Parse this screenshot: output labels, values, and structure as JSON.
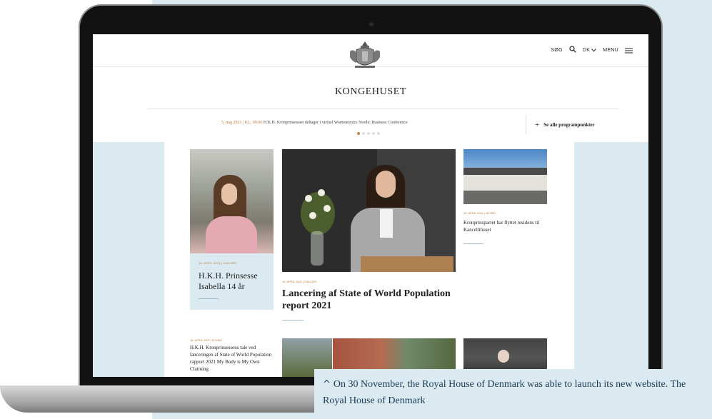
{
  "site": {
    "search_label": "SØG",
    "language_label": "DK",
    "menu_label": "MENU",
    "brand": "KONGEHUSET"
  },
  "ticker": {
    "date": "5. maj 2021 | KL. 09:00",
    "text": "H.K.H. Kronprinsessen deltager i virtuel Womenomics Nordic Business Conference",
    "all_link": "Se alle programpunkter",
    "active_dot": 1,
    "dot_count": 5
  },
  "cards": [
    {
      "meta": "18. APRIL 2021 | GALLERI",
      "title": "H.K.H. Prinsesse Isabella 14 år"
    },
    {
      "meta": "15. APRIL 2021 | GALLERI",
      "title": "Lancering af State of World Population report 2021"
    },
    {
      "meta": "15. APRIL 2021 | NYHED",
      "title": "Kronprinsparret har flyttet residens til Kancellihuset"
    },
    {
      "meta": "18. APRIL 2021 | NYHED",
      "title": "H.K.H. Kronprinsessens tale ved lanceringen af State of World Population rapport 2021 My Body is My Own Claiming"
    }
  ],
  "caption": {
    "caret": "^",
    "text": "On 30 November, the Royal House of Denmark was able to launch its new website. The Royal House of Denmark"
  },
  "icons": [
    "crest-icon",
    "search-icon",
    "chevron-down-icon",
    "hamburger-icon",
    "plus-icon",
    "caret-up-icon"
  ],
  "colors": {
    "accent": "#b87a3a",
    "panel": "#dbeaf0",
    "caption_text": "#1a3b55"
  }
}
